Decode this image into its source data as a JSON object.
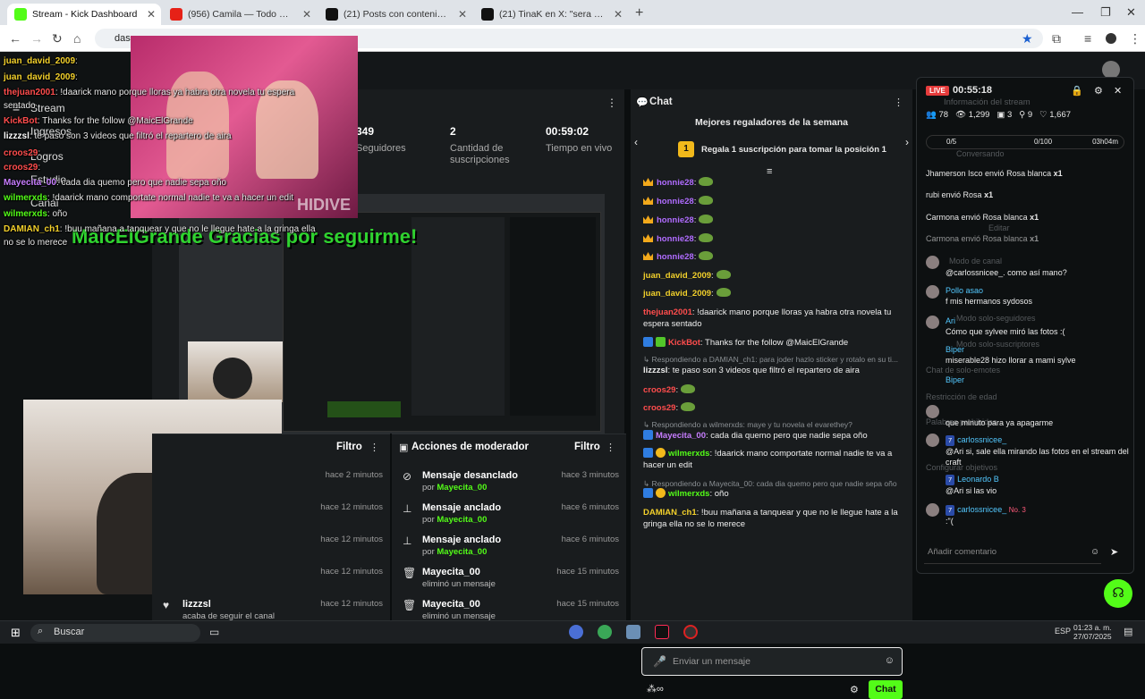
{
  "browser": {
    "tabs": [
      {
        "label": "Stream - Kick Dashboard",
        "active": true,
        "favicon": "kick-icon"
      },
      {
        "label": "(956) Camila — Todo Camb",
        "active": false,
        "favicon": "youtube-icon"
      },
      {
        "label": "(21) Posts con contenido multim",
        "active": false,
        "favicon": "x-icon"
      },
      {
        "label": "(21) TinaK en X: \"sera verdad e",
        "active": false,
        "favicon": "x-icon"
      }
    ],
    "url": "das"
  },
  "overlay": {
    "lines": [
      {
        "user": "juan_david_2009",
        "text": ":"
      },
      {
        "user": "juan_david_2009",
        "text": ":"
      },
      {
        "user": "thejuan2001",
        "text": ": !daarick mano porque lloras ya habra otra novela tu espera"
      },
      {
        "user": "",
        "text": "sentado"
      },
      {
        "user": "KickBot",
        "text": ": Thanks for the follow @MaicElGrande"
      },
      {
        "user": "lizzzsl",
        "text": ": te paso son 3 videos que filtró el repartero de aira"
      },
      {
        "user": "croos29",
        "text": ":"
      },
      {
        "user": "croos29",
        "text": ":"
      },
      {
        "user": "Mayecita_00",
        "text": ": cada dia quemo pero que nadie sepa oño"
      },
      {
        "user": "wilmerxds",
        "text": ": !daarick mano comportate normal nadie te va a hacer un edit"
      },
      {
        "user": "wilmerxds",
        "text": ": oño"
      },
      {
        "user": "DAMIAN_ch1",
        "text": ": !buu mañana a tanquear y que no le llegue hate a la gringa ella"
      },
      {
        "user": "",
        "text": "no se lo merece"
      }
    ],
    "follow_banner": "MaicElGrande Gracias por seguirme!",
    "hidive": "HIDIVE"
  },
  "left_nav": {
    "items": [
      "Stream",
      "Ingresos",
      "Logros",
      "Estudio",
      "Canal"
    ]
  },
  "stats": {
    "items": [
      {
        "value": "349",
        "label": "Seguidores"
      },
      {
        "value": "2",
        "label": "Cantidad de suscripciones"
      },
      {
        "value": "00:59:02",
        "label": "Tiempo en vivo"
      }
    ]
  },
  "activity": {
    "filter_label": "Filtro",
    "rows": [
      {
        "time": "hace 2 minutos"
      },
      {
        "time": "hace 12 minutos"
      },
      {
        "time": "hace 12 minutos"
      },
      {
        "time": "hace 12 minutos"
      },
      {
        "time": "hace 12 minutos"
      }
    ],
    "last_user": "lizzzsl",
    "last_sub": "acaba de seguir el canal"
  },
  "mod_actions": {
    "title": "Acciones de moderador",
    "filter_label": "Filtro",
    "rows": [
      {
        "title": "Mensaje desanclado",
        "prefix": "por",
        "user": "Mayecita_00",
        "time": "hace 3 minutos",
        "icon": "unpin-icon"
      },
      {
        "title": "Mensaje anclado",
        "prefix": "por",
        "user": "Mayecita_00",
        "time": "hace 6 minutos",
        "icon": "pin-icon"
      },
      {
        "title": "Mensaje anclado",
        "prefix": "por",
        "user": "Mayecita_00",
        "time": "hace 6 minutos",
        "icon": "pin-icon"
      },
      {
        "title": "Mayecita_00",
        "prefix": "eliminó un mensaje",
        "user": "",
        "time": "hace 15 minutos",
        "icon": "trash-icon"
      },
      {
        "title": "Mayecita_00",
        "prefix": "eliminó un mensaje",
        "user": "",
        "time": "hace 15 minutos",
        "icon": "trash-icon"
      }
    ]
  },
  "chat": {
    "title": "Chat",
    "top_gifters": "Mejores regaladores de la semana",
    "gift_rank": "1",
    "gift_prompt": "Regala 1 suscripción para tomar la posición 1",
    "messages": [
      {
        "user": "honnie28",
        "text": ":",
        "color": "purple",
        "badge": "crown"
      },
      {
        "user": "honnie28",
        "text": ":",
        "color": "purple",
        "badge": "crown"
      },
      {
        "user": "honnie28",
        "text": ":",
        "color": "purple",
        "badge": "crown"
      },
      {
        "user": "honnie28",
        "text": ":",
        "color": "purple",
        "badge": "crown"
      },
      {
        "user": "honnie28",
        "text": ":",
        "color": "purple",
        "badge": "crown"
      },
      {
        "user": "juan_david_2009",
        "text": ":",
        "color": "yellow",
        "badge": ""
      },
      {
        "user": "juan_david_2009",
        "text": ":",
        "color": "yellow",
        "badge": ""
      },
      {
        "user": "thejuan2001",
        "text": ": !daarick mano porque lloras ya habra otra novela tu espera sentado",
        "color": "red",
        "badge": ""
      },
      {
        "user": "KickBot",
        "text": ": Thanks for the follow @MaicElGrande",
        "color": "red",
        "badge": "bot"
      },
      {
        "reply": "Respondiendo a DAMIAN_ch1: para joder hazlo sticker y rotalo en su ti..."
      },
      {
        "user": "lizzzsl",
        "text": ": te paso son 3 videos que filtró el repartero de aira",
        "color": "white",
        "badge": ""
      },
      {
        "user": "croos29",
        "text": ":",
        "color": "red",
        "badge": ""
      },
      {
        "user": "croos29",
        "text": ":",
        "color": "red",
        "badge": ""
      },
      {
        "reply": "Respondiendo a wilmerxds: maye y tu novela el evarethey?"
      },
      {
        "user": "Mayecita_00",
        "text": ": cada dia quemo pero que nadie sepa oño",
        "color": "lilac",
        "badge": "mod"
      },
      {
        "user": "wilmerxds",
        "text": ": !daarick mano comportate normal nadie te va a hacer un edit",
        "color": "green",
        "badge": "mod"
      },
      {
        "reply": "Respondiendo a Mayecita_00: cada dia quemo pero que nadie sepa oño"
      },
      {
        "user": "wilmerxds",
        "text": ": oño",
        "color": "green",
        "badge": "mod"
      },
      {
        "user": "DAMIAN_ch1",
        "text": ": !buu mañana a tanquear y que no le llegue hate a la gringa ella no se lo merece",
        "color": "yellow",
        "badge": ""
      }
    ],
    "input_placeholder": "Enviar un mensaje",
    "send_label": "Chat"
  },
  "mobile": {
    "live_label": "LIVE",
    "timer": "00:55:18",
    "ghost_title": "Información del stream",
    "stats": [
      "78",
      "1,299",
      "3",
      "9",
      "1,667"
    ],
    "goal": "0/5",
    "goal2": "0/100",
    "goal_time": "03h04m",
    "gifts": [
      {
        "user": "Jhamerson Isco",
        "text": "envió Rosa blanca",
        "mult": "x1"
      },
      {
        "user": "rubi",
        "text": "envió Rosa",
        "mult": "x1"
      },
      {
        "user": "Carmona",
        "text": "envió Rosa blanca",
        "mult": "x1"
      },
      {
        "user": "Carmona",
        "text": "envió Rosa blanca",
        "mult": "x1"
      }
    ],
    "messages": [
      {
        "user": "",
        "text": "@carlossnicee_. como así mano?"
      },
      {
        "user": "Pollo asao",
        "text": "f mis hermanos sydosos"
      },
      {
        "user": "Ari",
        "text": "Cómo que sylvee miró las fotos :("
      },
      {
        "user": "Biper",
        "text": "miserable28 hizo llorar a mami sylve"
      },
      {
        "user": "Biper",
        "text": ""
      },
      {
        "user": "",
        "text": "que minuto para ya apagarme"
      },
      {
        "user": "carlossnicee_",
        "text": "@Ari si, sale ella mirando las fotos en el stream del craft",
        "badge": "7"
      },
      {
        "user": "Leonardo B",
        "text": "@Ari si las vio",
        "badge": "7"
      },
      {
        "user": "carlossnicee_",
        "text": ":\"(",
        "badge": "7",
        "tag": "No. 3"
      }
    ],
    "ghost_items": [
      "Conversando",
      "Editar",
      "Modo de canal",
      "Modo solo-seguidores",
      "Modo solo-suscriptores",
      "Chat de solo-emotes",
      "Restricción de edad",
      "Palabras prohibidas",
      "Configurar objetivos"
    ],
    "comment_placeholder": "Añadir comentario"
  },
  "taskbar": {
    "search": "Buscar",
    "lang": "ESP",
    "time": "01:23 a. m.",
    "date": "27/07/2025"
  }
}
